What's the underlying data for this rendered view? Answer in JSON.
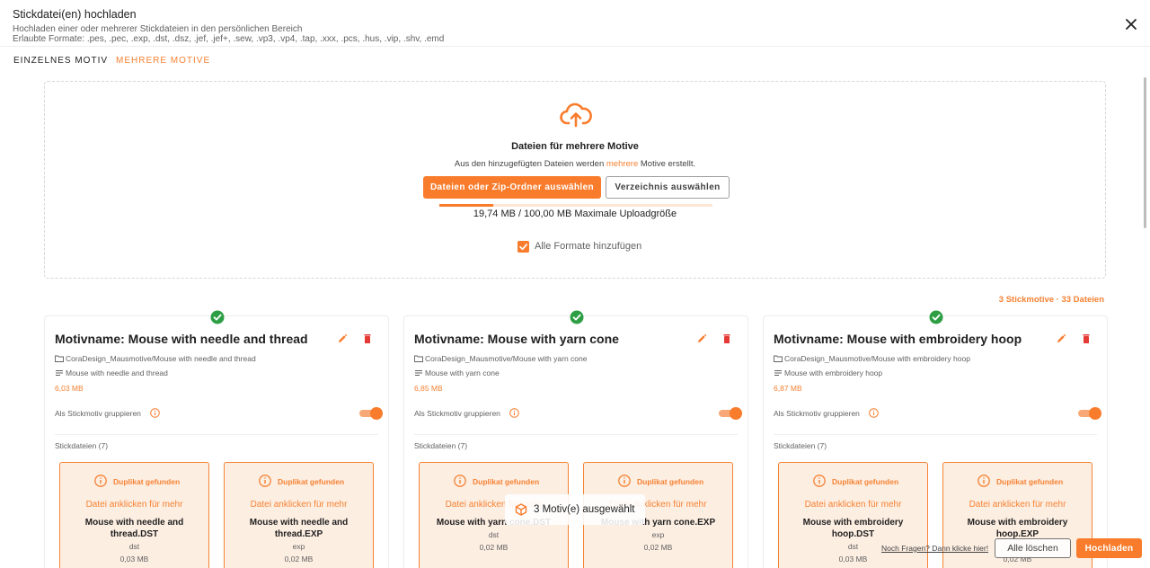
{
  "header": {
    "title": "Stickdatei(en) hochladen",
    "subtitle": "Hochladen einer oder mehrerer Stickdateien in den persönlichen Bereich",
    "formats": "Erlaubte Formate: .pes, .pec, .exp, .dst, .dsz, .jef, .jef+, .sew, .vp3, .vp4, .tap, .xxx, .pcs, .hus, .vip, .shv, .emd"
  },
  "tabs": [
    {
      "label": "EINZELNES MOTIV",
      "active": true
    },
    {
      "label": "MEHRERE MOTIVE",
      "active": false
    }
  ],
  "dropzone": {
    "icon": "cloud-upload-icon",
    "title": "Dateien für mehrere Motive",
    "desc_before": "Aus den hinzugefügten Dateien werden ",
    "desc_highlight": "mehrere",
    "desc_after": " Motive erstellt.",
    "btn_files": "Dateien oder Zip-Ordner auswählen",
    "btn_dir": "Verzeichnis auswählen",
    "upload_fraction": 0.197,
    "size_text": "19,74 MB / 100,00 MB Maximale Uploadgröße",
    "checkbox_label": "Alle Formate hinzufügen",
    "checkbox_checked": true
  },
  "counts": "3 Stickmotive · 33 Dateien",
  "cards": [
    {
      "name": "Motivname: Mouse with needle and thread",
      "path": "CoraDesign_Mausmotive/Mouse with needle and thread",
      "desc": "Mouse with needle and thread",
      "size": "6,03 MB",
      "group_label": "Als Stickmotiv gruppieren",
      "files_label": "Stickdateien (7)",
      "files": [
        {
          "dup": "Duplikat gefunden",
          "more": "Datei anklicken für mehr",
          "name": "Mouse with needle and thread.DST",
          "ext": "dst",
          "size": "0,03 MB"
        },
        {
          "dup": "Duplikat gefunden",
          "more": "Datei anklicken für mehr",
          "name": "Mouse with needle and thread.EXP",
          "ext": "exp",
          "size": "0,02 MB"
        }
      ]
    },
    {
      "name": "Motivname: Mouse with yarn cone",
      "path": "CoraDesign_Mausmotive/Mouse with yarn cone",
      "desc": "Mouse with yarn cone",
      "size": "6,85 MB",
      "group_label": "Als Stickmotiv gruppieren",
      "files_label": "Stickdateien (7)",
      "files": [
        {
          "dup": "Duplikat gefunden",
          "more": "Datei anklicken für mehr",
          "name": "Mouse with yarn cone.DST",
          "ext": "dst",
          "size": "0,02 MB"
        },
        {
          "dup": "Duplikat gefunden",
          "more": "Datei anklicken für mehr",
          "name": "Mouse with yarn cone.EXP",
          "ext": "exp",
          "size": "0,02 MB"
        }
      ]
    },
    {
      "name": "Motivname: Mouse with embroidery hoop",
      "path": "CoraDesign_Mausmotive/Mouse with embroidery hoop",
      "desc": "Mouse with embroidery hoop",
      "size": "6,87 MB",
      "group_label": "Als Stickmotiv gruppieren",
      "files_label": "Stickdateien (7)",
      "files": [
        {
          "dup": "Duplikat gefunden",
          "more": "Datei anklicken für mehr",
          "name": "Mouse with embroidery hoop.DST",
          "ext": "dst",
          "size": "0,03 MB"
        },
        {
          "dup": "Duplikat gefunden",
          "more": "Datei anklicken für mehr",
          "name": "Mouse with embroidery hoop.EXP",
          "ext": "exp",
          "size": "0,02 MB"
        }
      ]
    }
  ],
  "selected": "3 Motiv(e) ausgewählt",
  "footer": {
    "help": "Noch Fragen? Dann klicke hier!",
    "clear": "Alle löschen",
    "upload": "Hochladen"
  },
  "colors": {
    "accent": "#f97c2c",
    "success": "#2e9e44",
    "danger": "#e53935"
  }
}
